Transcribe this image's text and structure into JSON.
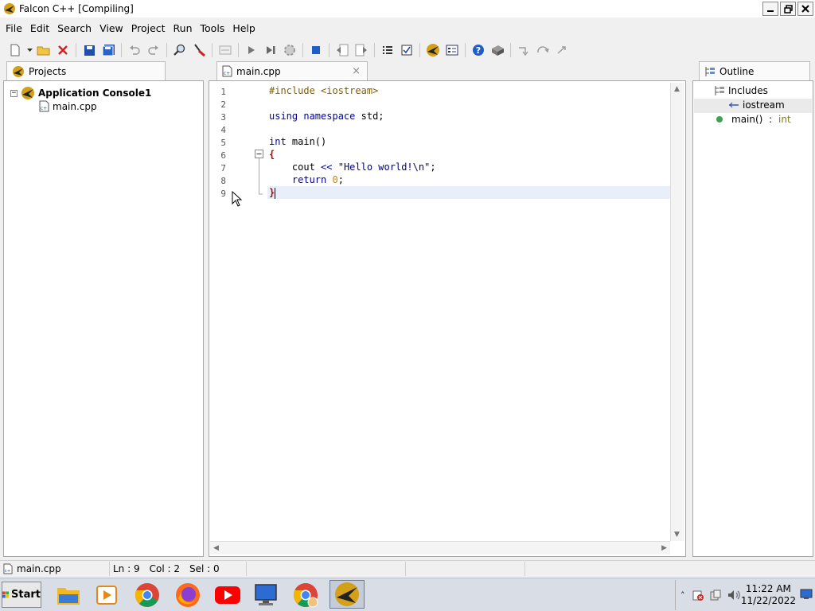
{
  "window": {
    "title": "Falcon C++ [Compiling]"
  },
  "menu": [
    "File",
    "Edit",
    "Search",
    "View",
    "Project",
    "Run",
    "Tools",
    "Help"
  ],
  "toolbar": {
    "icons": [
      "new-file-icon",
      "dropdown-icon",
      "open-folder-icon",
      "close-icon",
      "save-icon",
      "save-all-icon",
      "undo-icon",
      "redo-icon",
      "find-icon",
      "replace-icon",
      "toggle-comment-icon",
      "run-icon",
      "run-to-end-icon",
      "build-icon",
      "stop-icon",
      "back-icon",
      "forward-icon",
      "list-icon",
      "checklist-icon",
      "falcon-icon",
      "properties-icon",
      "help-icon",
      "package-icon",
      "step-into-icon",
      "step-over-icon",
      "step-out-icon"
    ]
  },
  "projects_panel": {
    "tab_label": "Projects",
    "project_name": "Application Console1",
    "files": [
      "main.cpp"
    ],
    "expander": "−"
  },
  "editor": {
    "tab_label": "main.cpp",
    "close_glyph": "×",
    "current_line": 9,
    "line_numbers": [
      "1",
      "2",
      "3",
      "4",
      "5",
      "6",
      "7",
      "8",
      "9"
    ],
    "lines": {
      "l1_pp": "#include <iostream>",
      "l3_kw1": "using",
      "l3_kw2": "namespace",
      "l3_rest": " std;",
      "l5_kw": "int",
      "l5_rest": " main()",
      "l6_brace": "{",
      "l7_pre": "    cout ",
      "l7_op": "<<",
      "l7_str": "\"Hello world!\\n\"",
      "l7_end": ";",
      "l8_pre": "    ",
      "l8_kw": "return",
      "l8_num": "0",
      "l8_end": ";",
      "l9_brace": "}"
    }
  },
  "outline_panel": {
    "tab_label": "Outline",
    "includes_label": "Includes",
    "include_item": "iostream",
    "function_name": "main()",
    "function_sep": " : ",
    "function_type": "int"
  },
  "statusbar": {
    "file": "main.cpp",
    "line": "Ln : 9",
    "column": "Col : 2",
    "selection": "Sel : 0"
  },
  "taskbar": {
    "start_label": "Start",
    "apps": [
      "file-explorer-icon",
      "media-player-icon",
      "chrome-icon",
      "firefox-icon",
      "youtube-icon",
      "my-computer-icon",
      "chrome-user-icon",
      "falcon-cpp-icon"
    ],
    "time": "11:22 AM",
    "date": "11/22/2022"
  },
  "colors": {
    "keyword": "#0000a0",
    "preprocessor": "#806000",
    "number": "#d08000",
    "brace": "#c00000",
    "function_type": "#808000",
    "current_line": "#e8eefa"
  }
}
